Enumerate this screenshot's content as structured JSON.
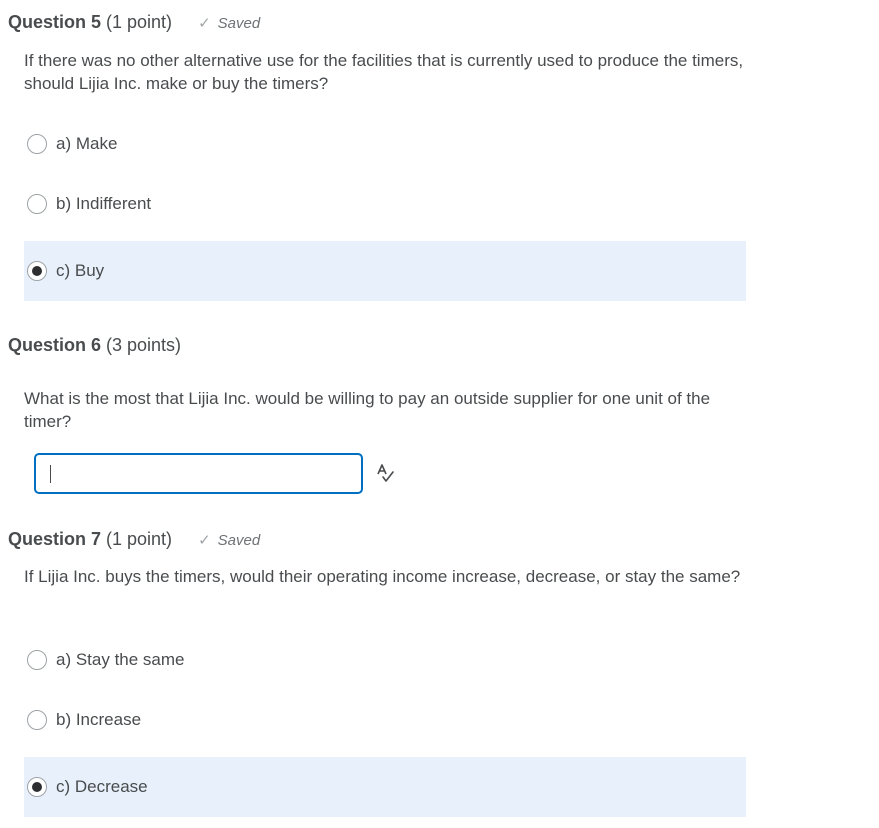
{
  "questions": [
    {
      "title": "Question 5",
      "points": "(1 point)",
      "status": "Saved",
      "text": "If there was no other alternative use for the facilities that is currently used to produce the timers, should Lijia Inc. make or buy the timers?",
      "options": [
        {
          "label": "a) Make",
          "selected": false
        },
        {
          "label": "b) Indifferent",
          "selected": false
        },
        {
          "label": "c) Buy",
          "selected": true
        }
      ]
    },
    {
      "title": "Question 6",
      "points": "(3 points)",
      "text": "What is the most that Lijia Inc. would be willing to pay an outside supplier for one unit of the timer?",
      "answer_value": "",
      "answer_placeholder": "",
      "spellcheck_icon": "spellcheck-icon"
    },
    {
      "title": "Question 7",
      "points": "(1 point)",
      "status": "Saved",
      "text": "If Lijia Inc. buys the timers, would their operating income increase, decrease, or stay the same?",
      "options": [
        {
          "label": "a) Stay the same",
          "selected": false
        },
        {
          "label": "b) Increase",
          "selected": false
        },
        {
          "label": "c) Decrease",
          "selected": true
        }
      ]
    }
  ],
  "icons": {
    "saved": "checkmark-icon",
    "spellcheck": "spellcheck-icon"
  },
  "colors": {
    "text": "#494c4e",
    "selected_bg": "#e8f1fb",
    "input_border": "#006fbf",
    "saved_check": "#a0a4a7"
  }
}
